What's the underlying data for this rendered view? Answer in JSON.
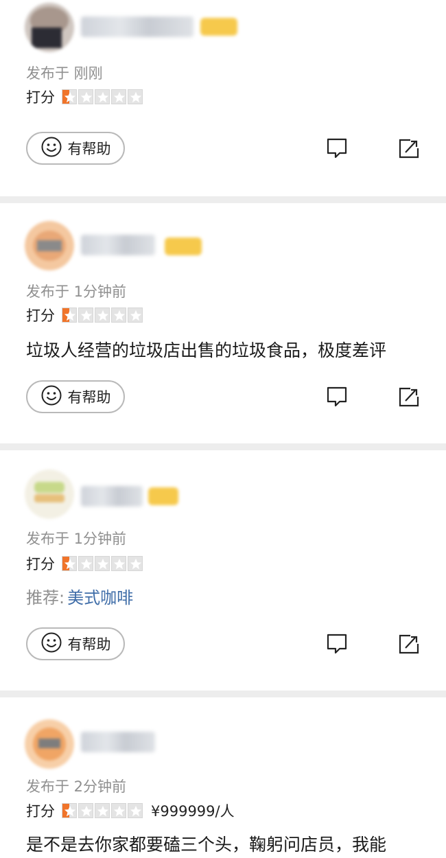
{
  "reviews": [
    {
      "published": "发布于 刚刚",
      "score_label": "打分",
      "rating": 0.5,
      "helpful_label": "有帮助"
    },
    {
      "published": "发布于 1分钟前",
      "score_label": "打分",
      "rating": 0.5,
      "content": "垃圾人经营的垃圾店出售的垃圾食品，极度差评",
      "helpful_label": "有帮助"
    },
    {
      "published": "发布于 1分钟前",
      "score_label": "打分",
      "rating": 0.5,
      "recommend_label": "推荐:",
      "recommend_value": "美式咖啡",
      "helpful_label": "有帮助"
    },
    {
      "published": "发布于 2分钟前",
      "score_label": "打分",
      "rating": 0.5,
      "price": "¥999999/人",
      "content": "是不是去你家都要磕三个头，鞠躬问店员，我能"
    }
  ],
  "icons": {
    "helpful": "smile-icon",
    "comment": "comment-icon",
    "share": "share-icon",
    "star": "star-icon"
  },
  "colors": {
    "star_filled": "#f0742a",
    "star_empty": "#e4e4e4",
    "recommend_link": "#3f6da8",
    "badge": "#f6c94c",
    "page_bg": "#ededed"
  }
}
